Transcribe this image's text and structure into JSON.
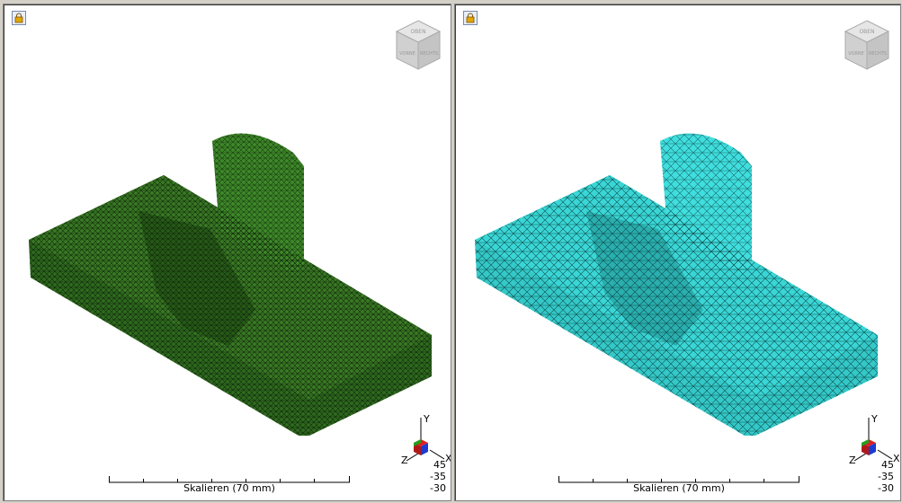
{
  "viewports": [
    {
      "id": "left",
      "mesh_color": "#2f6b1f",
      "face_labels": {
        "top": "OBEN",
        "front": "VORNE",
        "right": "RECHTS"
      },
      "triad": {
        "y": "Y",
        "z": "Z",
        "x": "X"
      },
      "angles": [
        "45",
        "-35",
        "-30"
      ],
      "scale_label": "Skalieren (70 mm)"
    },
    {
      "id": "right",
      "mesh_color": "#34c8c8",
      "face_labels": {
        "top": "OBEN",
        "front": "VORNE",
        "right": "RECHTS"
      },
      "triad": {
        "y": "Y",
        "z": "Z",
        "x": "X"
      },
      "angles": [
        "45",
        "-35",
        "-30"
      ],
      "scale_label": "Skalieren (70 mm)"
    }
  ],
  "icons": {
    "lock": "lock-icon",
    "navcube": "view-cube-icon"
  }
}
